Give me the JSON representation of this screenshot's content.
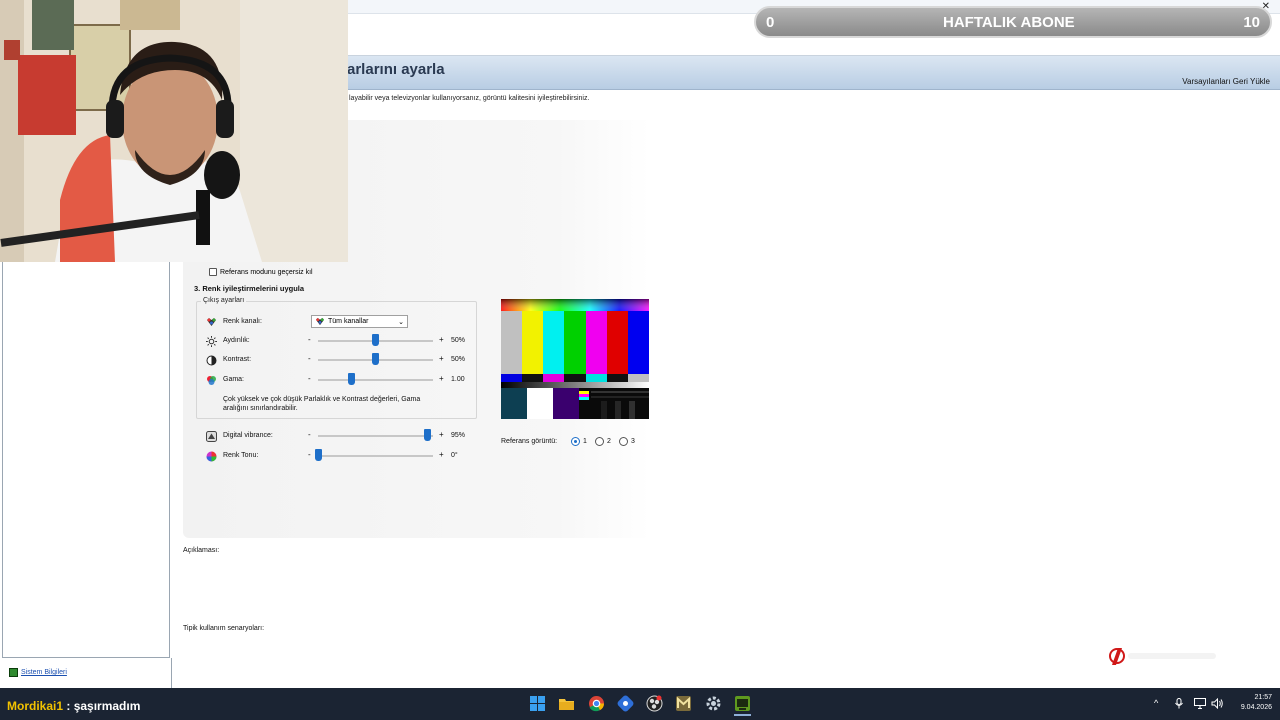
{
  "window": {
    "title": "arlarını ayarla",
    "restore_defaults": "Varsayılanları Geri Yükle",
    "subtitle": "layabilir veya televizyonlar kullanıyorsanız, görüntü kalitesini iyileştirebilirsiniz."
  },
  "sidebar": {
    "system_info": "Sistem Bilgileri"
  },
  "panel": {
    "override_checkbox": "Referans modunu geçersiz kıl",
    "section3": "3. Renk iyileştirmelerini uygula",
    "output_group": "Çıkış ayarları",
    "channel_label": "Renk kanalı:",
    "channel_value": "Tüm kanallar",
    "brightness": {
      "label": "Aydınlık:",
      "value": "50%",
      "level": 0.5
    },
    "contrast": {
      "label": "Kontrast:",
      "value": "50%",
      "level": 0.5
    },
    "gamma": {
      "label": "Gama:",
      "value": "1.00",
      "level": 0.29
    },
    "note": "Çok yüksek ve çok düşük Parlaklık ve Kontrast değerleri, Gama aralığını sınırlandırabilir.",
    "vibrance": {
      "label": "Digital vibrance:",
      "value": "95%",
      "level": 0.95
    },
    "hue": {
      "label": "Renk Tonu:",
      "value": "0°",
      "level": 0.0
    },
    "minus": "-",
    "plus": "+",
    "reference_label": "Referans görüntü:",
    "reference_options": [
      "1",
      "2",
      "3"
    ],
    "reference_selected": "1"
  },
  "description_label": "Açıklaması:",
  "typical_label": "Tipik kullanım senaryoları:",
  "overlay": {
    "left": "0",
    "title": "HAFTALIK ABONE",
    "right": "10"
  },
  "chat": {
    "user": "Mordikai1",
    "sep": " : ",
    "message": "şaşırmadım"
  },
  "clock": {
    "time": "21:57",
    "date": "9.04.2026"
  },
  "colors": {
    "accent": "#1e6fc9",
    "taskbar": "#1b2433",
    "chat_user": "#f2c200"
  }
}
